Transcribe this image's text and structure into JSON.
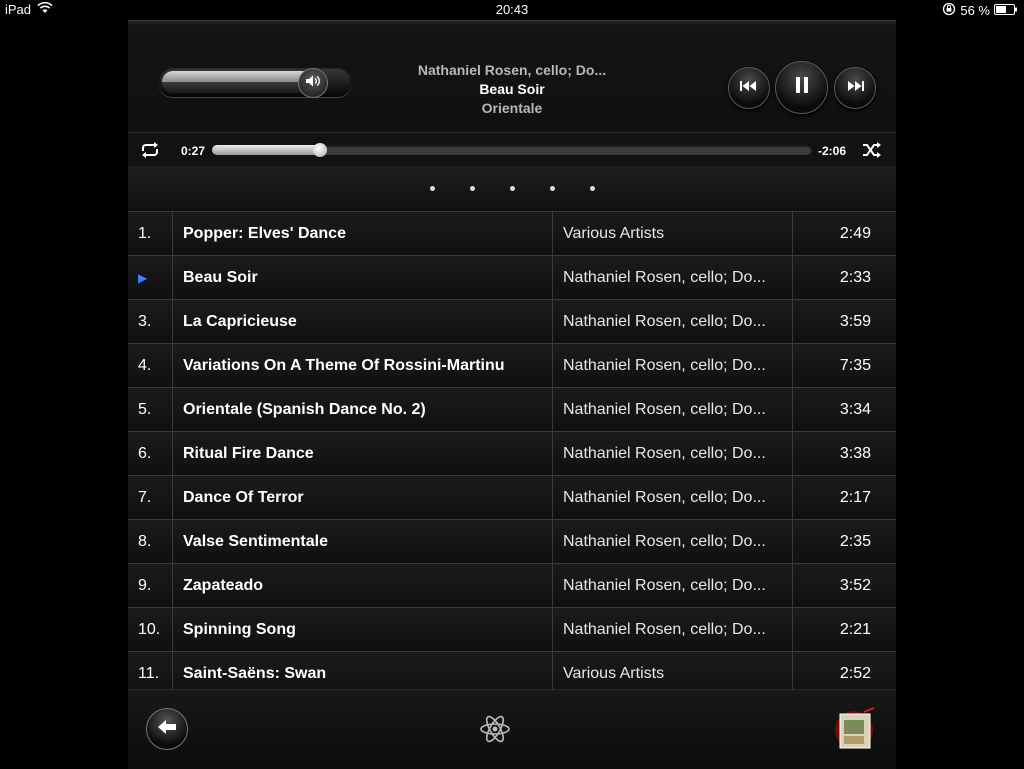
{
  "status_bar": {
    "device": "iPad",
    "time": "20:43",
    "battery_percent": "56 %"
  },
  "now_playing": {
    "artist": "Nathaniel Rosen, cello; Do...",
    "song": "Beau Soir",
    "album": "Orientale",
    "volume_level": 0.85,
    "elapsed": "0:27",
    "remaining": "-2:06",
    "progress": 0.18
  },
  "page_dots_count": 5,
  "tracks": [
    {
      "num": "1.",
      "title": "Popper: Elves' Dance",
      "artist": "Various Artists",
      "time": "2:49",
      "playing": false
    },
    {
      "num": "",
      "title": "Beau Soir",
      "artist": "Nathaniel Rosen, cello; Do...",
      "time": "2:33",
      "playing": true
    },
    {
      "num": "3.",
      "title": "La Capricieuse",
      "artist": "Nathaniel Rosen, cello; Do...",
      "time": "3:59",
      "playing": false
    },
    {
      "num": "4.",
      "title": "Variations On A Theme Of Rossini-Martinu",
      "artist": "Nathaniel Rosen, cello; Do...",
      "time": "7:35",
      "playing": false
    },
    {
      "num": "5.",
      "title": "Orientale (Spanish Dance No. 2)",
      "artist": "Nathaniel Rosen, cello; Do...",
      "time": "3:34",
      "playing": false
    },
    {
      "num": "6.",
      "title": "Ritual Fire Dance",
      "artist": "Nathaniel Rosen, cello; Do...",
      "time": "3:38",
      "playing": false
    },
    {
      "num": "7.",
      "title": "Dance Of Terror",
      "artist": "Nathaniel Rosen, cello; Do...",
      "time": "2:17",
      "playing": false
    },
    {
      "num": "8.",
      "title": "Valse Sentimentale",
      "artist": "Nathaniel Rosen, cello; Do...",
      "time": "2:35",
      "playing": false
    },
    {
      "num": "9.",
      "title": "Zapateado",
      "artist": "Nathaniel Rosen, cello; Do...",
      "time": "3:52",
      "playing": false
    },
    {
      "num": "10.",
      "title": "Spinning Song",
      "artist": "Nathaniel Rosen, cello; Do...",
      "time": "2:21",
      "playing": false
    },
    {
      "num": "11.",
      "title": "Saint-Saëns: Swan",
      "artist": "Various Artists",
      "time": "2:52",
      "playing": false
    }
  ],
  "colors": {
    "accent_play_indicator": "#3d7fff"
  }
}
